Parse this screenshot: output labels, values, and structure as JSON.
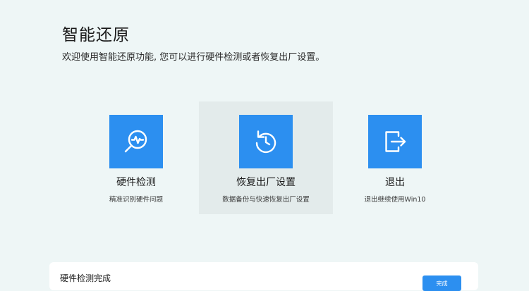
{
  "header": {
    "title": "智能还原",
    "subtitle": "欢迎使用智能还原功能, 您可以进行硬件检测或者恢复出厂设置。"
  },
  "options": [
    {
      "icon": "hardware-diagnostic-icon",
      "title": "硬件检测",
      "description": "精准识别硬件问题",
      "selected": false
    },
    {
      "icon": "restore-icon",
      "title": "恢复出厂设置",
      "description": "数据备份与快速恢复出厂设置",
      "selected": true
    },
    {
      "icon": "exit-icon",
      "title": "退出",
      "description": "退出继续使用Win10",
      "selected": false
    }
  ],
  "status_panel": {
    "message": "硬件检测完成",
    "done_label": "完成"
  },
  "colors": {
    "background": "#eef6f6",
    "accent": "#2c8ff0",
    "selected_background": "#e3ebeb",
    "panel": "#ffffff"
  }
}
